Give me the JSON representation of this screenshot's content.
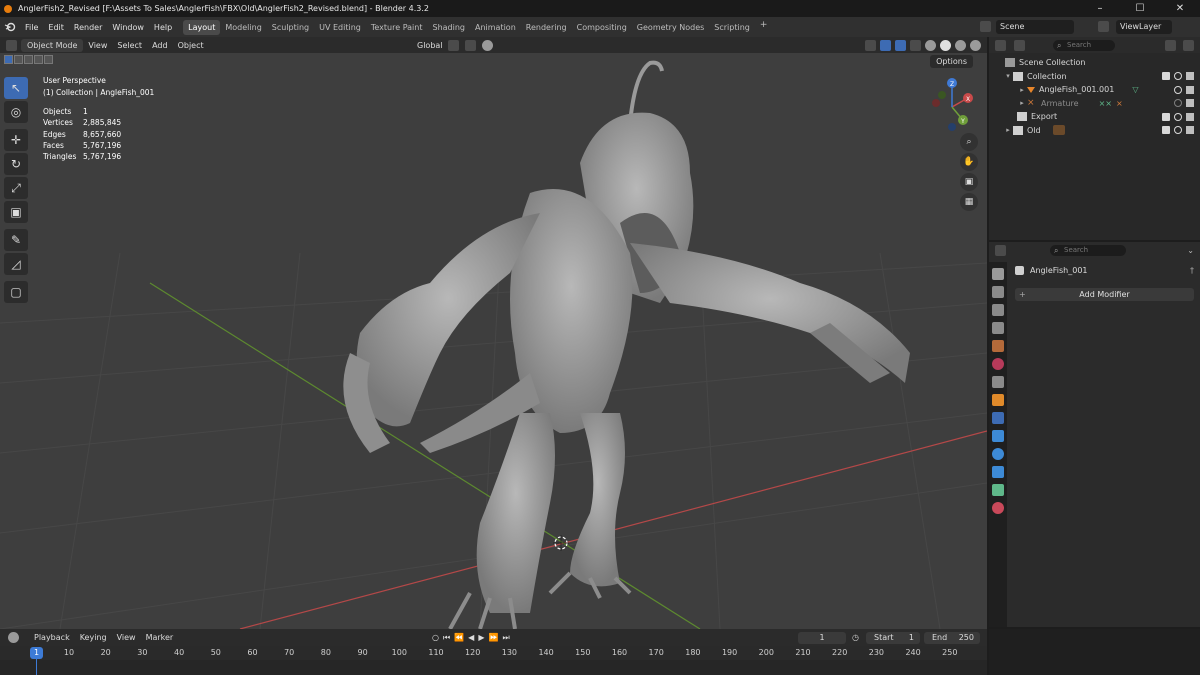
{
  "titlebar": {
    "title": "AnglerFish2_Revised [F:\\Assets To Sales\\AnglerFish\\FBX\\Old\\AnglerFish2_Revised.blend] - Blender 4.3.2",
    "minimize": "–",
    "maximize": "☐",
    "close": "✕"
  },
  "menu": [
    "File",
    "Edit",
    "Render",
    "Window",
    "Help"
  ],
  "workspaces": [
    "Layout",
    "Modeling",
    "Sculpting",
    "UV Editing",
    "Texture Paint",
    "Shading",
    "Animation",
    "Rendering",
    "Compositing",
    "Geometry Nodes",
    "Scripting"
  ],
  "workspace_add": "+",
  "scene": "Scene",
  "view_layer": "ViewLayer",
  "viewport_header": {
    "mode": "Object Mode",
    "menus": [
      "View",
      "Select",
      "Add",
      "Object"
    ],
    "orientation": "Global"
  },
  "viewport": {
    "perspective": "User Perspective",
    "collection_info": "(1) Collection | AngleFish_001",
    "options": "Options",
    "stats": [
      {
        "label": "Objects",
        "value": "1"
      },
      {
        "label": "Vertices",
        "value": "2,885,845"
      },
      {
        "label": "Edges",
        "value": "8,657,660"
      },
      {
        "label": "Faces",
        "value": "5,767,196"
      },
      {
        "label": "Triangles",
        "value": "5,767,196"
      }
    ],
    "gizmo": {
      "x": "X",
      "y": "Y",
      "z": "Z"
    }
  },
  "outliner": {
    "search_placeholder": "Search",
    "items": [
      {
        "label": "Scene Collection"
      },
      {
        "label": "Collection"
      },
      {
        "label": "AngleFish_001.001"
      },
      {
        "label": "Armature"
      },
      {
        "label": "Export"
      },
      {
        "label": "Old"
      }
    ]
  },
  "properties": {
    "search_placeholder": "Search",
    "object_name": "AngleFish_001",
    "add_modifier": "Add Modifier"
  },
  "timeline": {
    "menus": [
      "Playback",
      "Keying",
      "View",
      "Marker"
    ],
    "current_frame": "1",
    "start_label": "Start",
    "start_value": "1",
    "end_label": "End",
    "end_value": "250",
    "playhead": "1",
    "ticks": [
      "10",
      "20",
      "30",
      "40",
      "50",
      "60",
      "70",
      "80",
      "90",
      "100",
      "110",
      "120",
      "130",
      "140",
      "150",
      "160",
      "170",
      "180",
      "190",
      "200",
      "210",
      "220",
      "230",
      "240",
      "250"
    ]
  },
  "colors": {
    "accent": "#3d6bb3",
    "blender_orange": "#e87d0d",
    "x_axis": "#c94a4a",
    "y_axis": "#6f9e3a",
    "z_axis": "#3f7ad6"
  }
}
